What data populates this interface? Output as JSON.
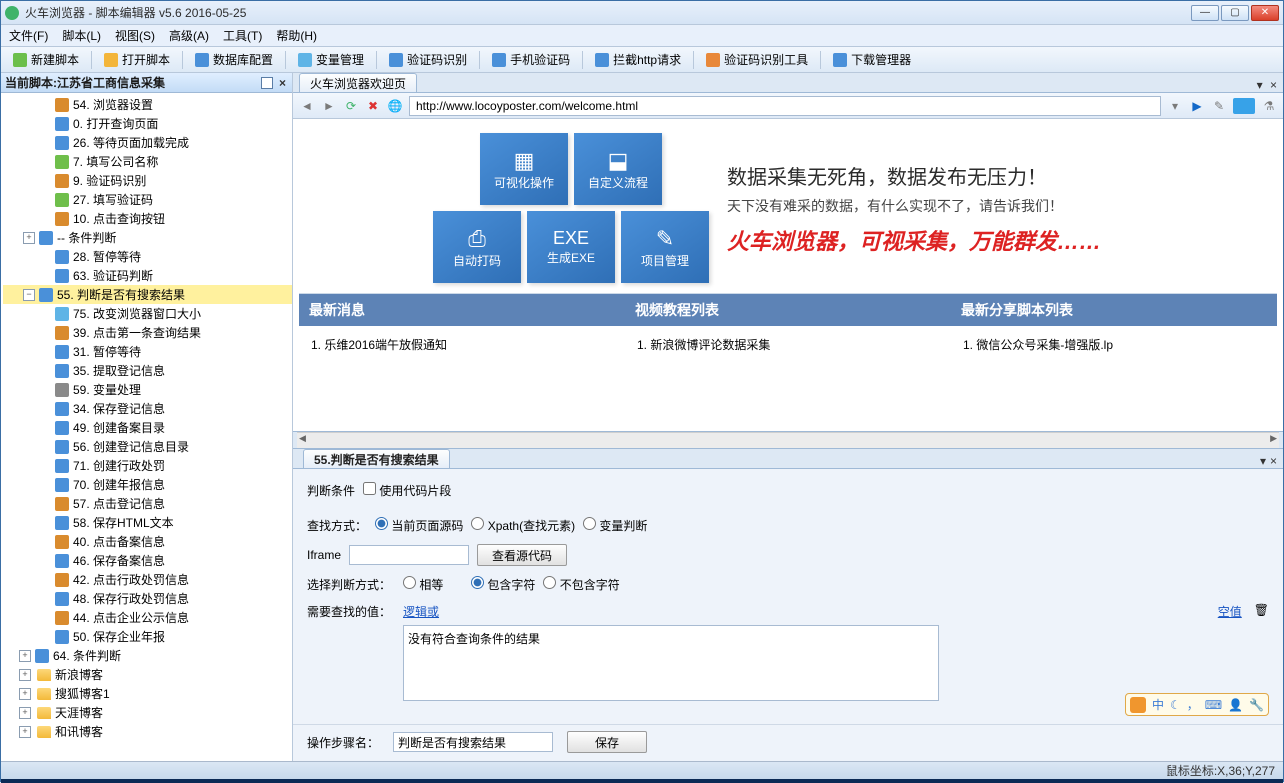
{
  "window": {
    "title": "火车浏览器 - 脚本编辑器 v5.6    2016-05-25"
  },
  "menu": [
    "文件(F)",
    "脚本(L)",
    "视图(S)",
    "高级(A)",
    "工具(T)",
    "帮助(H)"
  ],
  "toolbar": [
    {
      "label": "新建脚本",
      "c": "#6cbf4b"
    },
    {
      "label": "打开脚本",
      "c": "#f3b53a"
    },
    {
      "label": "数据库配置",
      "c": "#4a90d9"
    },
    {
      "label": "变量管理",
      "c": "#5fb4e6"
    },
    {
      "label": "验证码识别",
      "c": "#4a90d9"
    },
    {
      "label": "手机验证码",
      "c": "#4a90d9"
    },
    {
      "label": "拦截http请求",
      "c": "#4a90d9"
    },
    {
      "label": "验证码识别工具",
      "c": "#e8883a"
    },
    {
      "label": "下载管理器",
      "c": "#4a90d9"
    }
  ],
  "leftTitle": "当前脚本:江苏省工商信息采集",
  "tree": [
    {
      "t": "54. 浏览器设置",
      "c": "#d98b2e"
    },
    {
      "t": "0. 打开查询页面",
      "c": "#4a90d9"
    },
    {
      "t": "26. 等待页面加载完成",
      "c": "#4a90d9"
    },
    {
      "t": "7. 填写公司名称",
      "c": "#6fbf4b"
    },
    {
      "t": "9. 验证码识别",
      "c": "#d98b2e"
    },
    {
      "t": "27. 填写验证码",
      "c": "#6fbf4b"
    },
    {
      "t": "10. 点击查询按钮",
      "c": "#d98b2e"
    },
    {
      "t": "-- 条件判断",
      "c": "#4a90d9",
      "folder": true
    },
    {
      "t": "28. 暂停等待",
      "c": "#4a90d9"
    },
    {
      "t": "63. 验证码判断",
      "c": "#4a90d9"
    },
    {
      "t": "55. 判断是否有搜索结果",
      "c": "#4a90d9",
      "sel": true,
      "folder": true
    },
    {
      "t": "75. 改变浏览器窗口大小",
      "c": "#5fb4e6"
    },
    {
      "t": "39. 点击第一条查询结果",
      "c": "#d98b2e"
    },
    {
      "t": "31. 暂停等待",
      "c": "#4a90d9"
    },
    {
      "t": "35. 提取登记信息",
      "c": "#4a90d9"
    },
    {
      "t": "59. 变量处理",
      "c": "#8a8a8a"
    },
    {
      "t": "34. 保存登记信息",
      "c": "#4a90d9"
    },
    {
      "t": "49. 创建备案目录",
      "c": "#4a90d9"
    },
    {
      "t": "56. 创建登记信息目录",
      "c": "#4a90d9"
    },
    {
      "t": "71. 创建行政处罚",
      "c": "#4a90d9"
    },
    {
      "t": "70. 创建年报信息",
      "c": "#4a90d9"
    },
    {
      "t": "57. 点击登记信息",
      "c": "#d98b2e"
    },
    {
      "t": "58. 保存HTML文本",
      "c": "#4a90d9"
    },
    {
      "t": "40. 点击备案信息",
      "c": "#d98b2e"
    },
    {
      "t": "46. 保存备案信息",
      "c": "#4a90d9"
    },
    {
      "t": "42. 点击行政处罚信息",
      "c": "#d98b2e"
    },
    {
      "t": "48. 保存行政处罚信息",
      "c": "#4a90d9"
    },
    {
      "t": "44. 点击企业公示信息",
      "c": "#d98b2e"
    },
    {
      "t": "50. 保存企业年报",
      "c": "#4a90d9"
    },
    {
      "t": "64. 条件判断",
      "c": "#4a90d9",
      "folder": true,
      "lvl": 1
    }
  ],
  "folders": [
    "新浪博客",
    "搜狐博客1",
    "天涯博客",
    "和讯博客"
  ],
  "browserTab": "火车浏览器欢迎页",
  "url": "http://www.locoyposter.com/welcome.html",
  "tiles": {
    "top": [
      "可视化操作",
      "自定义流程"
    ],
    "bottom": [
      "自动打码",
      "生成EXE",
      "项目管理"
    ]
  },
  "hero": {
    "l1": "数据采集无死角，数据发布无压力！",
    "l2": "天下没有难采的数据，有什么实现不了，请告诉我们！",
    "l3": "火车浏览器，可视采集，万能群发……"
  },
  "columns": {
    "c1": {
      "h": "最新消息",
      "b": "1.  乐维2016端午放假通知"
    },
    "c2": {
      "h": "视频教程列表",
      "b": "1.  新浪微博评论数据采集"
    },
    "c3": {
      "h": "最新分享脚本列表",
      "b": "1.  微信公众号采集-增强版.lp"
    }
  },
  "editor": {
    "tab": "55.判断是否有搜索结果",
    "condLabel": "判断条件",
    "codeSnippet": "使用代码片段",
    "searchModeLabel": "查找方式：",
    "searchModes": [
      "当前页面源码",
      "Xpath(查找元素)",
      "变量判断"
    ],
    "iframeLabel": "Iframe",
    "viewSourceBtn": "查看源代码",
    "matchLabel": "选择判断方式：",
    "matches": [
      "相等",
      "包含字符",
      "不包含字符"
    ],
    "needLabel": "需要查找的值：",
    "logicOr": "逻辑或",
    "emptyVal": "空值",
    "textarea": "没有符合查询条件的结果",
    "stepNameLabel": "操作步骤名：",
    "stepName": "判断是否有搜索结果",
    "saveBtn": "保存"
  },
  "status": "鼠标坐标:X,36;Y,277"
}
